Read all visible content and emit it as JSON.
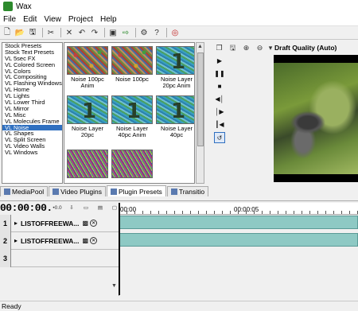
{
  "window": {
    "title": "Wax"
  },
  "menu": [
    "File",
    "Edit",
    "View",
    "Project",
    "Help"
  ],
  "toolbar_icons": [
    "new-icon",
    "open-icon",
    "save-icon",
    "cut-tool-icon",
    "delete-icon",
    "undo-icon",
    "redo-icon",
    "render-icon",
    "export-icon",
    "settings-icon",
    "help-icon",
    "plugin-icon"
  ],
  "presets": {
    "items": [
      "Stock Presets",
      "Stock Text Presets",
      "VL 5sec FX",
      "VL Colored Screen",
      "VL Colors",
      "VL Compositing",
      "VL Flashing Windows",
      "VL Home",
      "VL Lights",
      "VL Lower Third",
      "VL Mirror",
      "VL Misc",
      "VL Molecules Frame",
      "VL Noise",
      "VL Shapes",
      "VL Split Screen",
      "VL Video Walls",
      "VL Windows"
    ],
    "selected": "VL Noise"
  },
  "thumbnails": [
    {
      "caption_1": "Noise 100pc",
      "caption_2": "Anim",
      "style": "red"
    },
    {
      "caption_1": "Noise 100pc",
      "caption_2": "",
      "style": "red"
    },
    {
      "caption_1": "Noise Layer",
      "caption_2": "20pc Anim",
      "style": "blue"
    },
    {
      "caption_1": "Noise Layer",
      "caption_2": "20pc",
      "style": "blue"
    },
    {
      "caption_1": "Noise Layer",
      "caption_2": "40pc Anim",
      "style": "blue"
    },
    {
      "caption_1": "Noise Layer",
      "caption_2": "40pc",
      "style": "blue"
    },
    {
      "caption_1": "",
      "caption_2": "",
      "style": "dense"
    },
    {
      "caption_1": "",
      "caption_2": "",
      "style": "dense"
    }
  ],
  "preview": {
    "quality": "Draft Quality (Auto)"
  },
  "tabs": [
    {
      "label": "MediaPool",
      "active": false
    },
    {
      "label": "Video Plugins",
      "active": false
    },
    {
      "label": "Plugin Presets",
      "active": true
    },
    {
      "label": "Transitio",
      "active": false
    }
  ],
  "timeline": {
    "timecode": "00:00:00.",
    "ruler_labels": [
      "00:00",
      "00:00:05"
    ],
    "tracks": [
      {
        "num": "1",
        "name": "LISTOFFREEWA..."
      },
      {
        "num": "2",
        "name": "LISTOFFREEWA..."
      },
      {
        "num": "3",
        "name": ""
      }
    ]
  },
  "status": "Ready"
}
